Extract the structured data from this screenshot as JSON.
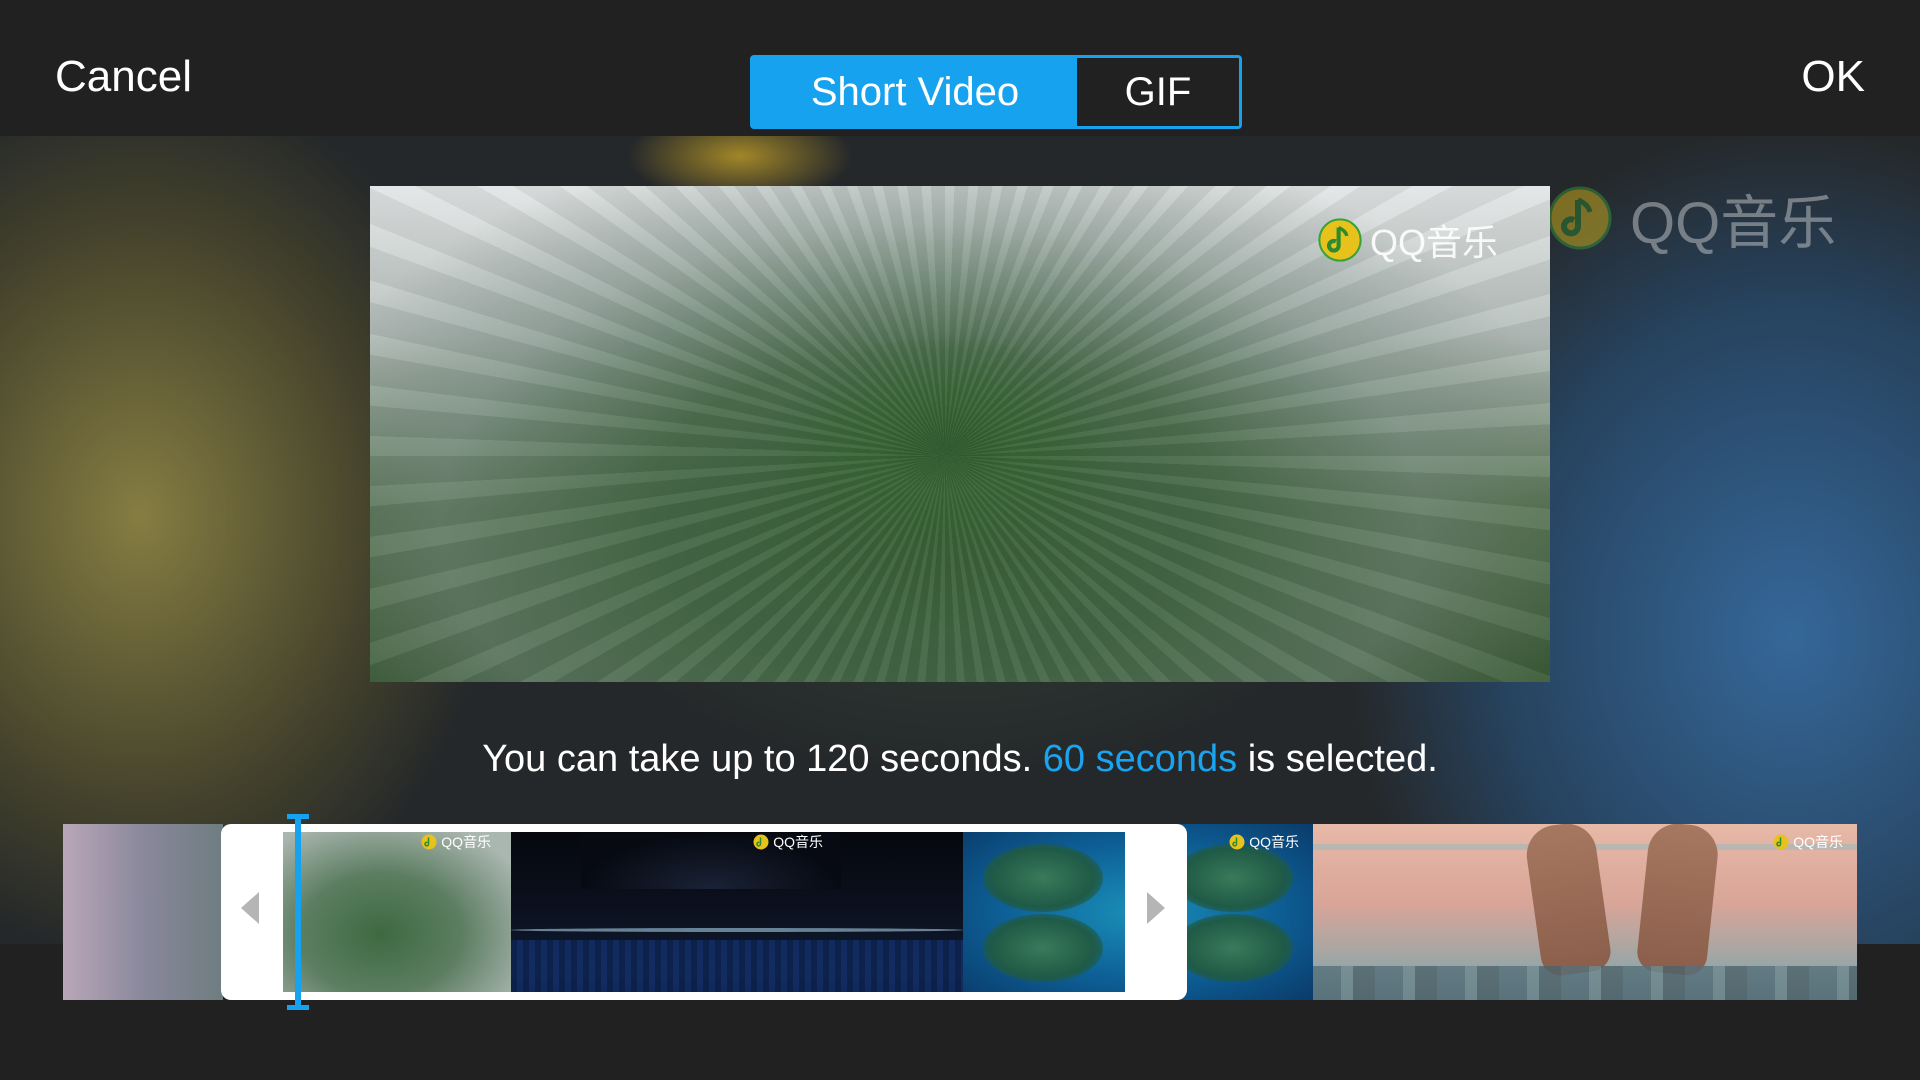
{
  "header": {
    "cancel_label": "Cancel",
    "ok_label": "OK",
    "segments": [
      {
        "label": "Short Video",
        "selected": true
      },
      {
        "label": "GIF",
        "selected": false
      }
    ]
  },
  "watermark": {
    "text": "QQ音乐",
    "icon": "qq-music-note-icon"
  },
  "info": {
    "prefix": "You can take up to 120 seconds. ",
    "highlight": "60 seconds",
    "suffix": " is selected."
  },
  "colors": {
    "accent": "#16a2ef",
    "background": "#212121",
    "text": "#ffffff"
  },
  "timeline": {
    "thumbnail_count": 5
  }
}
